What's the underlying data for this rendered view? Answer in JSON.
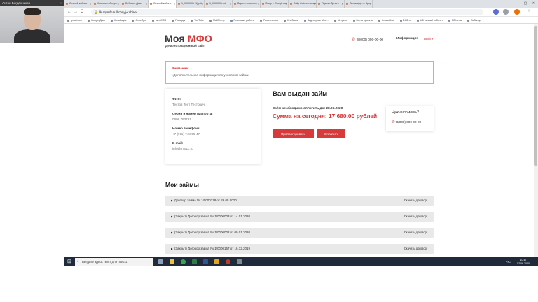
{
  "webcam": {
    "caption": "Антон Богданчиков",
    "close": "×"
  },
  "browser": {
    "tabs": [
      {
        "label": "Личный кабинет",
        "active": false
      },
      {
        "label": "Система обслуж.",
        "active": false
      },
      {
        "label": "Вебинар Дем.",
        "active": false
      },
      {
        "label": "Личный кабинет",
        "active": true
      },
      {
        "label": "1_0000001 (1).pdf",
        "active": false
      },
      {
        "label": "1_0000001.pdf",
        "active": false
      },
      {
        "label": "Видео на канале",
        "active": false
      },
      {
        "label": "Swap – Google Ac",
        "active": false
      },
      {
        "label": "Daily Calc это экзамен",
        "active": false
      },
      {
        "label": "Яндекс.Деньги",
        "active": false
      },
      {
        "label": "Тинькофф — Бро",
        "active": false
      }
    ],
    "tab_close": "×",
    "window_controls": [
      "—",
      "▢",
      "✕"
    ],
    "nav": {
      "back": "←",
      "forward": "→",
      "reload": "C",
      "home": "⌂"
    },
    "url": "lk.mymfo.ru/lichnyj-kabinet",
    "lock": "🔒",
    "bookmarks": [
      "gmail.com",
      "Google Диск",
      "Колабация",
      "ОписПрог",
      "amoCRM",
      "Разводы",
      "YouTube",
      "MailChimp",
      "Плановые работы",
      "Развлечения",
      "Хлебники",
      "Видеоуроки Мно...",
      "Метрика",
      "Карта проекта",
      "Блокчейны",
      "1МЕ.ru",
      "ЦБ личный кабинет",
      "1С Цены",
      "Вебинар"
    ]
  },
  "site": {
    "logo_prefix": "Моя",
    "logo_brand": "МФО",
    "logo_sub": "Демонстрационный сайт",
    "header_phone": "8(000) 000-00-00",
    "header_info": "Информация",
    "header_exit": "Выйти",
    "phone_icon": "✆",
    "alert": {
      "title": "Внимание!",
      "text": "«Дополнительная информация по условиям займа»"
    },
    "profile": {
      "fio_label": "ФИО:",
      "fio_value": "Тестов Тест Тестович",
      "passport_label": "Серия и номер паспорта:",
      "passport_value": "0808 763791",
      "phone_label": "Номер телефона:",
      "phone_value": "+7 (911) 748-55-47",
      "email_label": "E-mail:",
      "email_value": "info@info1c.ru"
    },
    "loan": {
      "title": "Вам выдан займ",
      "due": "Займ необходимо оплатить до: 28.06.2020",
      "sum": "Сумма на сегодня: 17 680.00 рублей",
      "extend_button": "Пролонгировать",
      "pay_button": "Оплатить"
    },
    "help": {
      "title": "Нужна помощь?",
      "phone": "8(000) 000-00-00"
    },
    "loans_title": "Мои займы",
    "loans": [
      {
        "label": "Договор займа № 1/0000178 от 29.05.2020",
        "download": "Скачать договор"
      },
      {
        "label": "(Закрыт) Договор займа № 1/0000003 от 14.01.2020",
        "download": "Скачать договор"
      },
      {
        "label": "(Закрыт) Договор займа № 1/0000002 от 09.01.2020",
        "download": "Скачать договор"
      },
      {
        "label": "(Закрыт) Договор займа № 1/0000167 от 16.12.2019",
        "download": "Скачать договор"
      }
    ]
  },
  "taskbar": {
    "search_placeholder": "Введите здесь текст для поиска",
    "start": "⊞",
    "search_icon": "⌕",
    "lang": "РУС",
    "time": "10:17",
    "date": "02.06.2020"
  },
  "colors": {
    "brand_red": "#d63a3a",
    "taskbar": "#1f2a3a"
  }
}
